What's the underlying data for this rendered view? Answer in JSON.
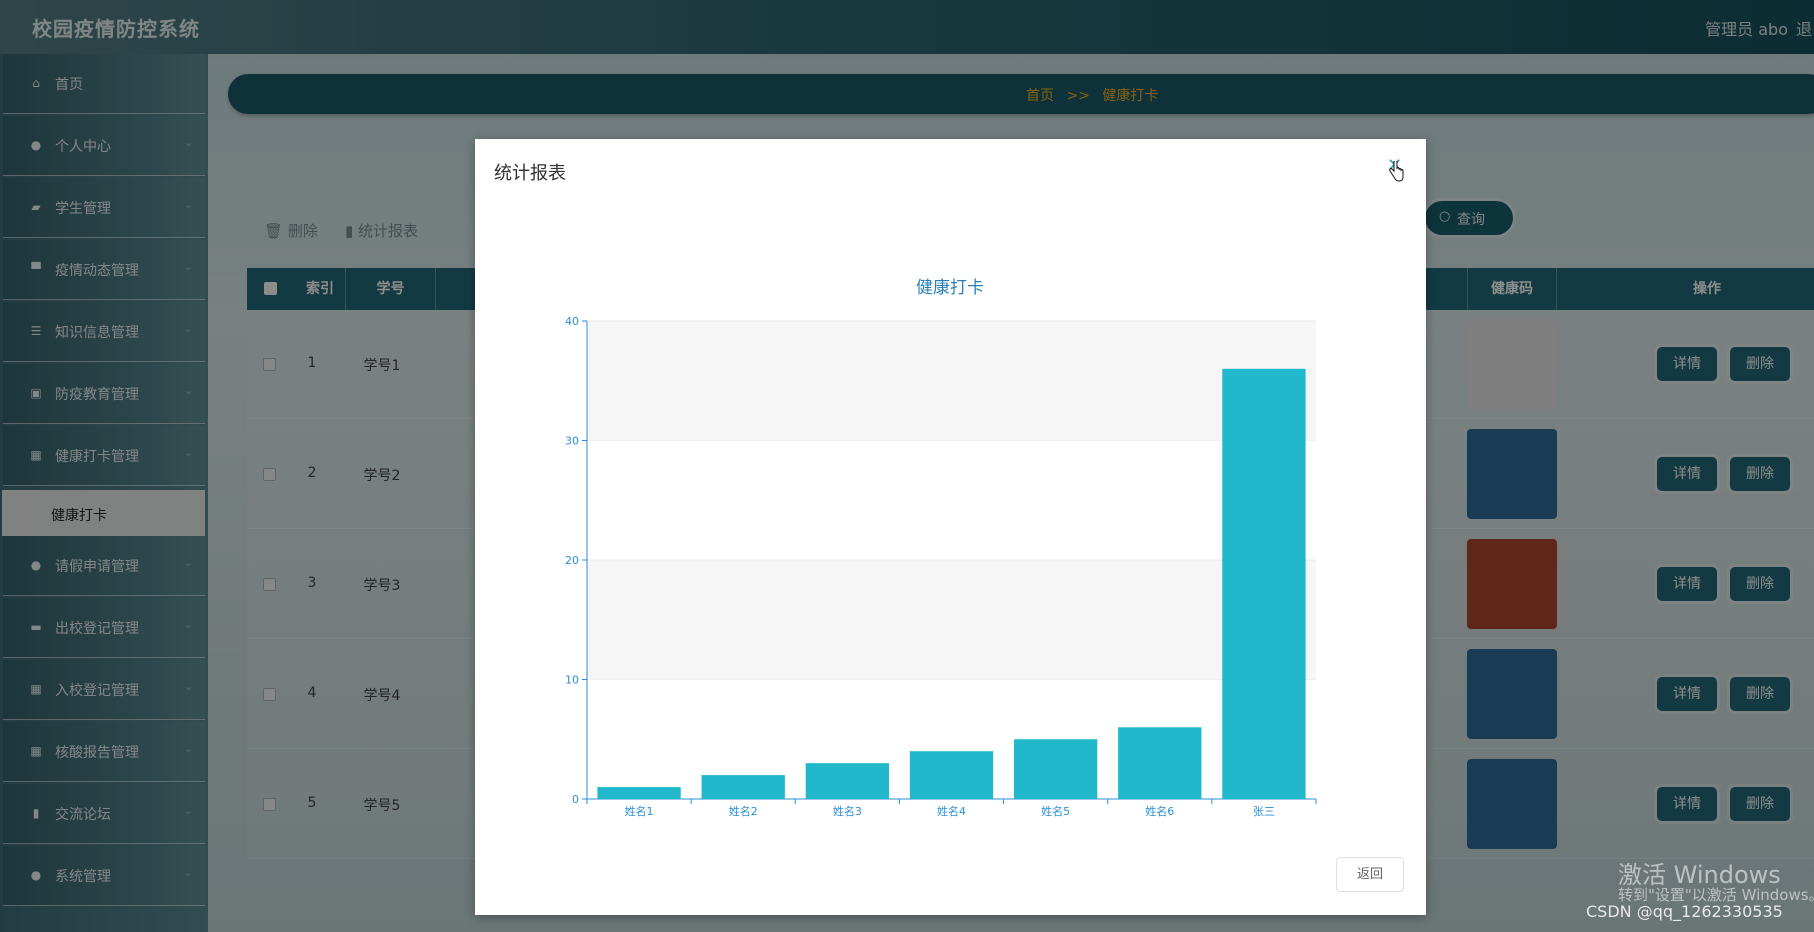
{
  "header": {
    "title": "校园疫情防控系统",
    "user": "管理员 abo",
    "user_extra": "退"
  },
  "sidebar": {
    "items": [
      {
        "label": "首页",
        "icon": "home-icon",
        "glyph": "⌂"
      },
      {
        "label": "个人中心",
        "icon": "user-icon",
        "glyph": "●"
      },
      {
        "label": "学生管理",
        "icon": "student-icon",
        "glyph": "▰"
      },
      {
        "label": "疫情动态管理",
        "icon": "monitor-icon",
        "glyph": "▀"
      },
      {
        "label": "知识信息管理",
        "icon": "list-icon",
        "glyph": "☰"
      },
      {
        "label": "防疫教育管理",
        "icon": "check-square-icon",
        "glyph": "▣"
      },
      {
        "label": "健康打卡管理",
        "icon": "grid-icon",
        "glyph": "▦"
      },
      {
        "label": "请假申请管理",
        "icon": "user-icon",
        "glyph": "●"
      },
      {
        "label": "出校登记管理",
        "icon": "comment-icon",
        "glyph": "▬"
      },
      {
        "label": "入校登记管理",
        "icon": "grid-icon",
        "glyph": "▦"
      },
      {
        "label": "核酸报告管理",
        "icon": "grid-icon",
        "glyph": "▦"
      },
      {
        "label": "交流论坛",
        "icon": "chart-icon",
        "glyph": "▮"
      },
      {
        "label": "系统管理",
        "icon": "location-icon",
        "glyph": "●"
      }
    ],
    "submenu": "健康打卡"
  },
  "breadcrumb": {
    "home": "首页",
    "sep": ">>",
    "current": "健康打卡"
  },
  "toolbar": {
    "delete_label": "删除",
    "stats_label": "统计报表",
    "query_label": "查询"
  },
  "table": {
    "headers": {
      "index": "索引",
      "student_no": "学号",
      "health_code": "健康码",
      "actions": "操作"
    },
    "rows": [
      {
        "index": "1",
        "student_no": "学号1"
      },
      {
        "index": "2",
        "student_no": "学号2"
      },
      {
        "index": "3",
        "student_no": "学号3"
      },
      {
        "index": "4",
        "student_no": "学号4"
      },
      {
        "index": "5",
        "student_no": "学号5"
      }
    ],
    "detail_label": "详情",
    "delete_label": "删除"
  },
  "modal": {
    "title": "统计报表",
    "close_glyph": "✕",
    "return_label": "返回"
  },
  "chart_data": {
    "type": "bar",
    "title": "健康打卡",
    "categories": [
      "姓名1",
      "姓名2",
      "姓名3",
      "姓名4",
      "姓名5",
      "姓名6",
      "张三"
    ],
    "values": [
      1,
      2,
      3,
      4,
      5,
      6,
      36
    ],
    "ylim": [
      0,
      40
    ],
    "yticks": [
      0,
      10,
      20,
      30,
      40
    ],
    "bar_color": "#21b8cb",
    "axis_color": "#2a8fd6",
    "grid": true
  },
  "watermark": {
    "line1": "激活 Windows",
    "line2": "转到\"设置\"以激活 Windows。"
  },
  "csdn": "CSDN @qq_1262330535",
  "colors": {
    "header": "#2f6873",
    "accent": "#236b79",
    "breadcrumb_text": "#f3b21d"
  }
}
